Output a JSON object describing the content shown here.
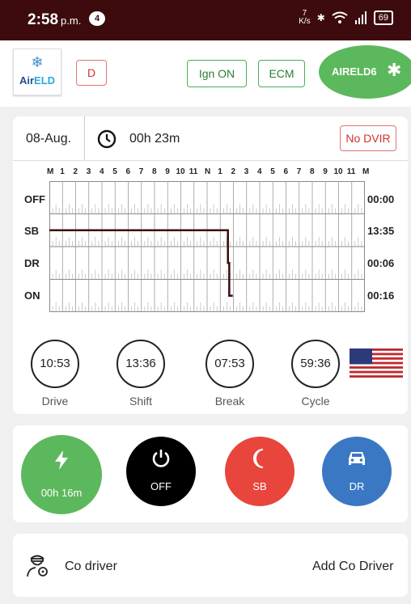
{
  "status_bar": {
    "time": "2:58",
    "ampm": "p.m.",
    "notif_count": "4",
    "net_speed_top": "7",
    "net_speed_bottom": "K/s",
    "battery": "69"
  },
  "topbar": {
    "logo_text_a": "Air",
    "logo_text_b": "ELD",
    "d_label": "D",
    "ign_label": "Ign ON",
    "ecm_label": "ECM",
    "device_label": "AIRELD6"
  },
  "log": {
    "date": "08-Aug.",
    "elapsed": "00h 23m",
    "dvir_label": "No DVIR",
    "hour_labels": [
      "M",
      "1",
      "2",
      "3",
      "4",
      "5",
      "6",
      "7",
      "8",
      "9",
      "10",
      "11",
      "N",
      "1",
      "2",
      "3",
      "4",
      "5",
      "6",
      "7",
      "8",
      "9",
      "10",
      "11",
      "M"
    ],
    "rows": [
      {
        "label": "OFF",
        "total": "00:00"
      },
      {
        "label": "SB",
        "total": "13:35"
      },
      {
        "label": "DR",
        "total": "00:06"
      },
      {
        "label": "ON",
        "total": "00:16"
      }
    ]
  },
  "timers": [
    {
      "value": "10:53",
      "label": "Drive"
    },
    {
      "value": "13:36",
      "label": "Shift"
    },
    {
      "value": "07:53",
      "label": "Break"
    },
    {
      "value": "59:36",
      "label": "Cycle"
    }
  ],
  "status_buttons": {
    "on": {
      "label": "00h 16m",
      "color": "#5cb85c"
    },
    "off": {
      "label": "OFF",
      "color": "#000000"
    },
    "sb": {
      "label": "SB",
      "color": "#e8453c"
    },
    "dr": {
      "label": "DR",
      "color": "#3a78c3"
    }
  },
  "co_driver": {
    "label": "Co driver",
    "add_label": "Add Co Driver"
  },
  "colors": {
    "status_bar": "#3d0b0e",
    "accent_green": "#5cb85c",
    "log_line": "#3d0b0e"
  }
}
